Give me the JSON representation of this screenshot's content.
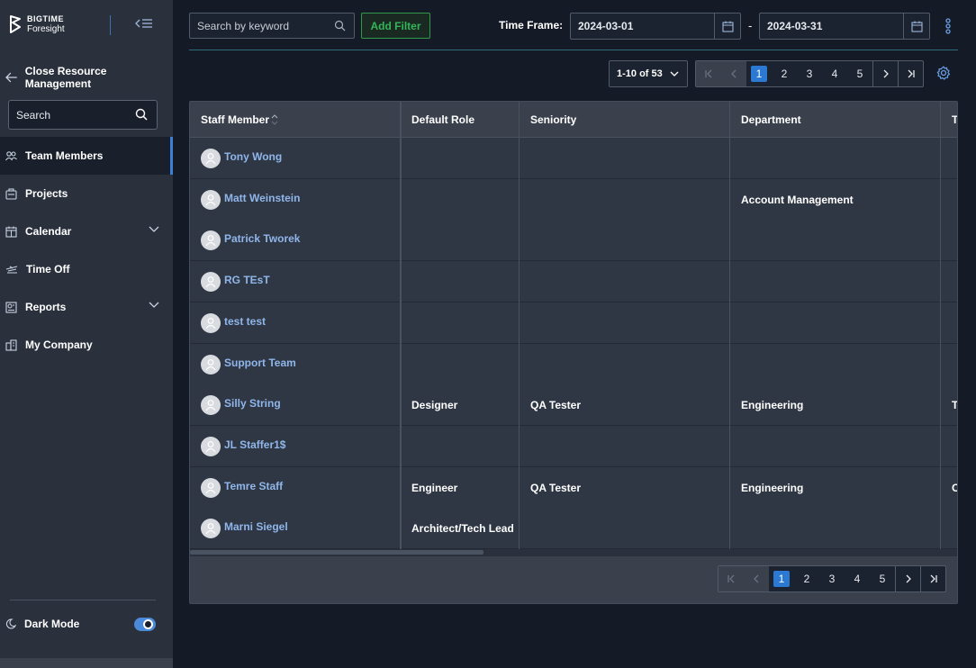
{
  "brand": {
    "line1": "BIGTIME",
    "line2": "Foresight"
  },
  "sidebar": {
    "back_label": "Close Resource Management",
    "search_placeholder": "Search",
    "items": [
      {
        "label": "Team Members",
        "icon": "people-icon",
        "active": true
      },
      {
        "label": "Projects",
        "icon": "briefcase-icon"
      },
      {
        "label": "Calendar",
        "icon": "calendar-icon",
        "expandable": true
      },
      {
        "label": "Time Off",
        "icon": "plane-icon"
      },
      {
        "label": "Reports",
        "icon": "report-icon",
        "expandable": true
      },
      {
        "label": "My Company",
        "icon": "building-icon"
      }
    ],
    "dark_mode_label": "Dark Mode",
    "dark_mode_on": true
  },
  "toolbar": {
    "search_placeholder": "Search by keyword",
    "add_filter_label": "Add Filter",
    "time_frame_label": "Time Frame:",
    "date_from": "2024-03-01",
    "date_separator": "-",
    "date_to": "2024-03-31"
  },
  "pagination": {
    "range_label": "1-10 of 53",
    "pages": [
      "1",
      "2",
      "3",
      "4",
      "5"
    ],
    "current_page": "1"
  },
  "table": {
    "columns": [
      "Staff Member",
      "Default Role",
      "Seniority",
      "Department",
      "T"
    ],
    "rows": [
      {
        "name": "Tony Wong",
        "role": "",
        "seniority": "",
        "department": "",
        "extra": ""
      },
      {
        "name": "Matt Weinstein",
        "role": "",
        "seniority": "",
        "department": "Account Management",
        "extra": ""
      },
      {
        "name": "Patrick Tworek",
        "role": "",
        "seniority": "",
        "department": "",
        "extra": ""
      },
      {
        "name": "RG TEsT",
        "role": "",
        "seniority": "",
        "department": "",
        "extra": ""
      },
      {
        "name": "test test",
        "role": "",
        "seniority": "",
        "department": "",
        "extra": ""
      },
      {
        "name": "Support Team",
        "role": "",
        "seniority": "",
        "department": "",
        "extra": ""
      },
      {
        "name": "Silly String",
        "role": "Designer",
        "seniority": "QA Tester",
        "department": "Engineering",
        "extra": "T"
      },
      {
        "name": "JL Staffer1$",
        "role": "",
        "seniority": "",
        "department": "",
        "extra": ""
      },
      {
        "name": "Temre Staff",
        "role": "Engineer",
        "seniority": "QA Tester",
        "department": "Engineering",
        "extra": "C"
      },
      {
        "name": "Marni Siegel",
        "role": "Architect/Tech Lead",
        "seniority": "",
        "department": "",
        "extra": ""
      }
    ]
  },
  "colors": {
    "accent": "#2b79d3",
    "filter_green": "#32b657",
    "link": "#8fb6ea"
  }
}
